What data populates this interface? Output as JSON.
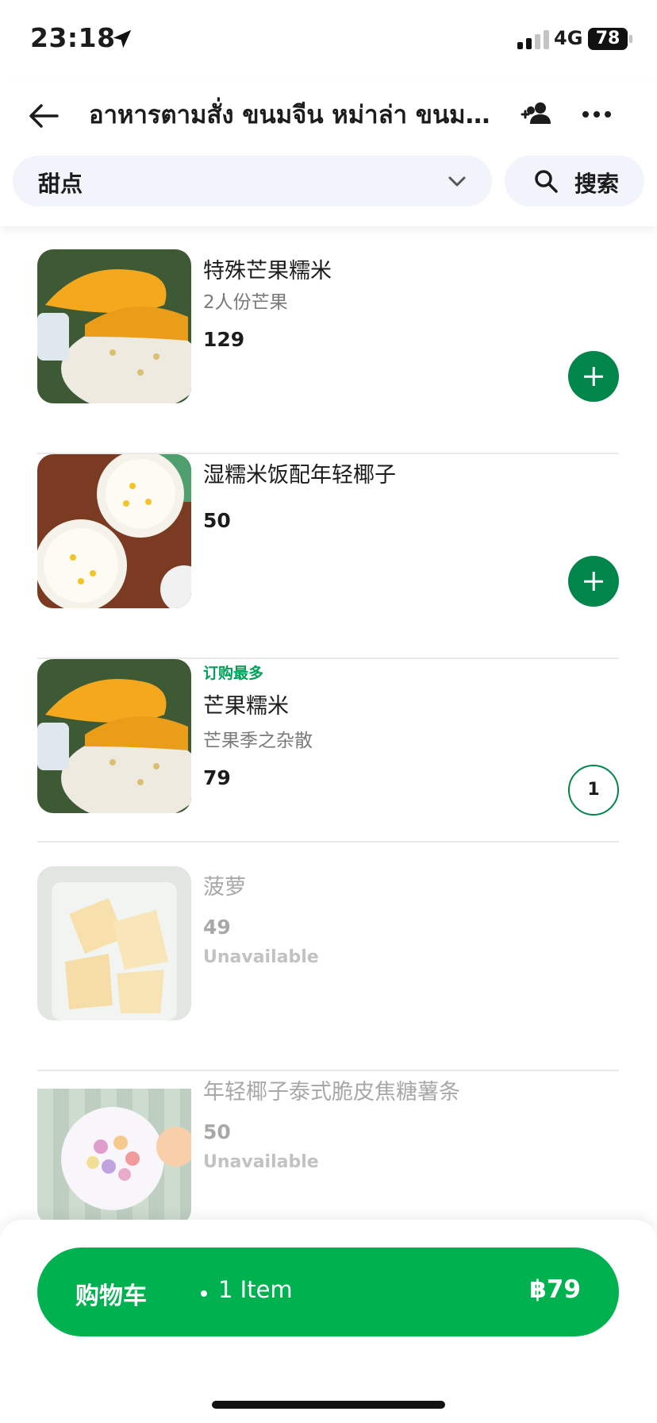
{
  "status_bar": {
    "time": "23:18",
    "network": "4G",
    "battery": "78",
    "icons": [
      "location-arrow-icon",
      "signal-icon",
      "battery-icon"
    ]
  },
  "header": {
    "title": "อาหารตามสั่ง ขนมจีน หม่าล่า ขนมหวาน",
    "icons": [
      "back-arrow-icon",
      "group-order-icon",
      "more-icon"
    ]
  },
  "filter": {
    "category": "甜点",
    "search_label": "搜索",
    "icons": [
      "chevron-down-icon",
      "search-icon"
    ]
  },
  "menu_items": [
    {
      "badge": "",
      "name": "特殊芒果糯米",
      "description": "2人份芒果",
      "price": "129",
      "status": "",
      "action": "add",
      "image": "mango-sticky-rice"
    },
    {
      "badge": "",
      "name": "湿糯米饭配年轻椰子",
      "description": "",
      "price": "50",
      "status": "",
      "action": "add",
      "image": "coconut-sticky-rice"
    },
    {
      "badge": "订购最多",
      "name": "芒果糯米",
      "description": "芒果季之杂散",
      "price": "79",
      "status": "",
      "action": "quantity",
      "quantity": "1",
      "image": "mango-sticky-rice"
    },
    {
      "badge": "",
      "name": "菠萝",
      "description": "",
      "price": "49",
      "status": "Unavailable",
      "action": "none",
      "image": "pineapple-cup"
    },
    {
      "badge": "",
      "name": "年轻椰子泰式脆皮焦糖薯条",
      "description": "",
      "price": "50",
      "status": "Unavailable",
      "action": "none",
      "image": "coconut-milk-dessert"
    }
  ],
  "cart": {
    "label": "购物车",
    "count": "1 Item",
    "total": "฿79"
  },
  "colors": {
    "primary_green": "#00b14f",
    "button_green": "#00854a",
    "badge_green": "#00a05a",
    "chip_bg": "#f1f4fa"
  }
}
